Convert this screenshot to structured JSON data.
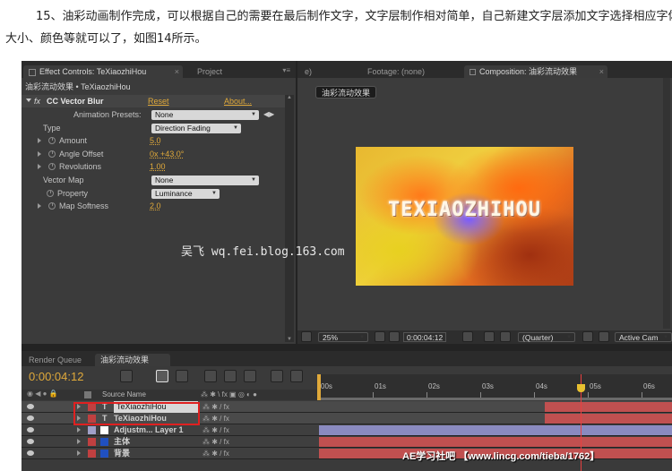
{
  "caption": {
    "line1": "15、油彩动画制作完成，可以根据自己的需要在最后制作文字，文字层制作相对简单，自己新建文字层添加文字选择相应字体、",
    "line2": "大小、颜色等就可以了，如图14所示。"
  },
  "effect_controls": {
    "tab_label": "Effect Controls: TeXiaozhiHou",
    "tab_project": "Project",
    "breadcrumb": "油彩流动效果 • TeXiaozhiHou",
    "effect_name": "CC Vector Blur",
    "reset": "Reset",
    "about": "About...",
    "properties": [
      {
        "label": "Animation Presets:",
        "value": "None",
        "kind": "dropdown"
      },
      {
        "label": "Type",
        "value": "Direction Fading",
        "kind": "dropdown"
      },
      {
        "label": "Amount",
        "value": "5.0",
        "kind": "number"
      },
      {
        "label": "Angle Offset",
        "value": "0x +43.0°",
        "kind": "number"
      },
      {
        "label": "Revolutions",
        "value": "1.00",
        "kind": "number"
      },
      {
        "label": "Vector Map",
        "value": "None",
        "kind": "dropdown"
      },
      {
        "label": "Property",
        "value": "Luminance",
        "kind": "dropdown"
      },
      {
        "label": "Map Softness",
        "value": "2.0",
        "kind": "number"
      }
    ]
  },
  "viewer": {
    "tab_left": "e)",
    "tab_footage": "Footage: (none)",
    "tab_comp": "Composition: 油彩流动效果",
    "comp_label": "油彩流动效果",
    "render_text": "TEXIAOZHIHOU",
    "watermark": "吴飞 wq.fei.blog.163.com",
    "zoom": "25%",
    "timecode": "0:00:04:12",
    "resolution": "(Quarter)",
    "active_camera": "Active Cam"
  },
  "timeline": {
    "tab_render": "Render Queue",
    "tab_comp": "油彩流动效果",
    "timecode": "0:00:04:12",
    "source_name_header": "Source Name",
    "ruler": [
      "00s",
      "01s",
      "02s",
      "03s",
      "04s",
      "05s",
      "06s"
    ],
    "playhead_fraction": 0.74,
    "layers": [
      {
        "type": "T",
        "name": "TeXiaozhiHou",
        "label_color": "#c04040",
        "bar_color": "#c05050",
        "bar_start": 0.64
      },
      {
        "type": "T",
        "name": "TeXiaozhiHou",
        "label_color": "#c04040",
        "bar_color": "#c05050",
        "bar_start": 0.64
      },
      {
        "type": "",
        "name": "Adjustm... Layer 1",
        "label_color": "#a0a0c8",
        "bar_color": "#8a8ac0",
        "bar_start": 0.0
      },
      {
        "type": "",
        "name": "主体",
        "label_color": "#c04040",
        "bar_color": "#c05050",
        "bar_start": 0.0
      },
      {
        "type": "",
        "name": "背景",
        "label_color": "#c04040",
        "bar_color": "#c05050",
        "bar_start": 0.0
      }
    ],
    "footer_watermark": "AE学习社吧 【www.lincg.com/tieba/1762】"
  }
}
